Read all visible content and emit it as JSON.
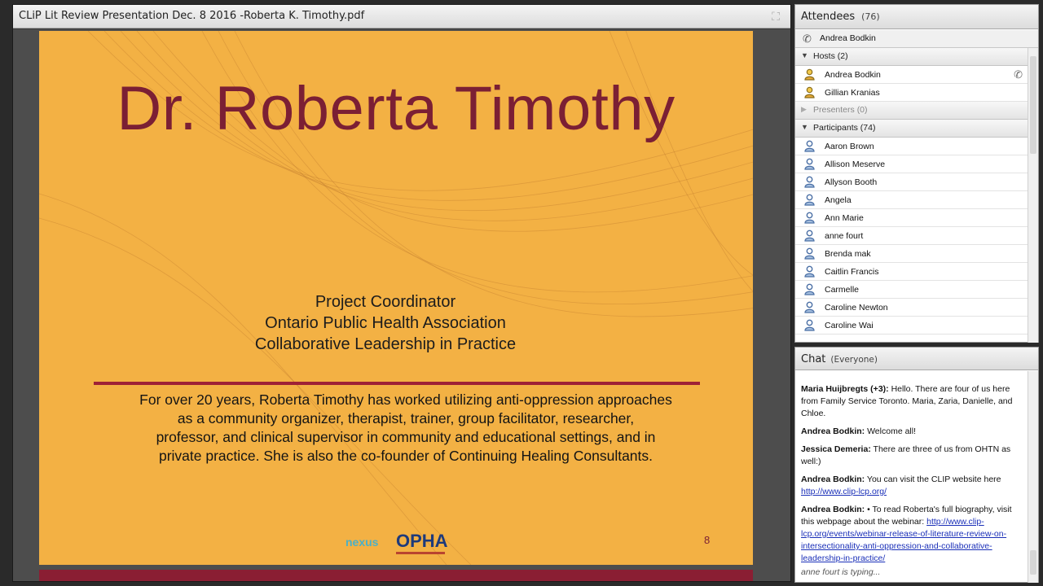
{
  "share": {
    "title": "CLiP Lit Review Presentation Dec. 8 2016 -Roberta K. Timothy.pdf",
    "fullscreen_icon": "fullscreen-icon"
  },
  "slide": {
    "title": "Dr. Roberta Timothy",
    "role_lines": [
      "Project Coordinator",
      "Ontario Public Health Association",
      "Collaborative Leadership in Practice"
    ],
    "bio_lines": [
      "For over 20 years, Roberta Timothy has worked utilizing anti-oppression approaches",
      "as a community organizer, therapist, trainer, group facilitator, researcher,",
      "professor, and clinical supervisor in community and educational settings, and in",
      "private practice. She is also the co-founder of Continuing Healing Consultants."
    ],
    "page_number": "8",
    "logo_left": "nexus",
    "logo_right": "OPHA",
    "colors": {
      "background": "#f3b144",
      "title": "#7b1f34",
      "rule": "#9e2136"
    }
  },
  "attendees": {
    "title": "Attendees",
    "count": "(76)",
    "me": "Andrea Bodkin",
    "groups": [
      {
        "label": "Hosts (2)",
        "expanded": true,
        "members": [
          "Andrea Bodkin",
          "Gillian Kranias"
        ]
      },
      {
        "label": "Presenters (0)",
        "expanded": false,
        "members": []
      },
      {
        "label": "Participants (74)",
        "expanded": true,
        "members": [
          "Aaron Brown",
          "Allison Meserve",
          "Allyson Booth",
          "Angela",
          "Ann Marie",
          "anne fourt",
          "Brenda mak",
          "Caitlin Francis",
          "Carmelle",
          "Caroline Newton",
          "Caroline Wai"
        ]
      }
    ]
  },
  "chat": {
    "title": "Chat",
    "scope": "(Everyone)",
    "messages": [
      {
        "sender": "Maria Huijbregts (+3):",
        "text": " Hello. There are four of us here from Family Service Toronto. Maria, Zaria, Danielle, and Chloe."
      },
      {
        "sender": "Andrea Bodkin:",
        "text": " Welcome all!"
      },
      {
        "sender": "Jessica Demeria:",
        "text": " There are three of us from OHTN as well:)"
      },
      {
        "sender": "Andrea Bodkin:",
        "text": " You can visit the CLIP website here ",
        "link": "http://www.clip-lcp.org/"
      },
      {
        "sender": "Andrea Bodkin:",
        "text": " •  To read Roberta's full biography, visit this webpage about the webinar: ",
        "link": "http://www.clip-lcp.org/events/webinar-release-of-literature-review-on-intersectionality-anti-oppression-and-collaborative-leadership-in-practice/"
      }
    ],
    "typing": "anne fourt is typing..."
  }
}
